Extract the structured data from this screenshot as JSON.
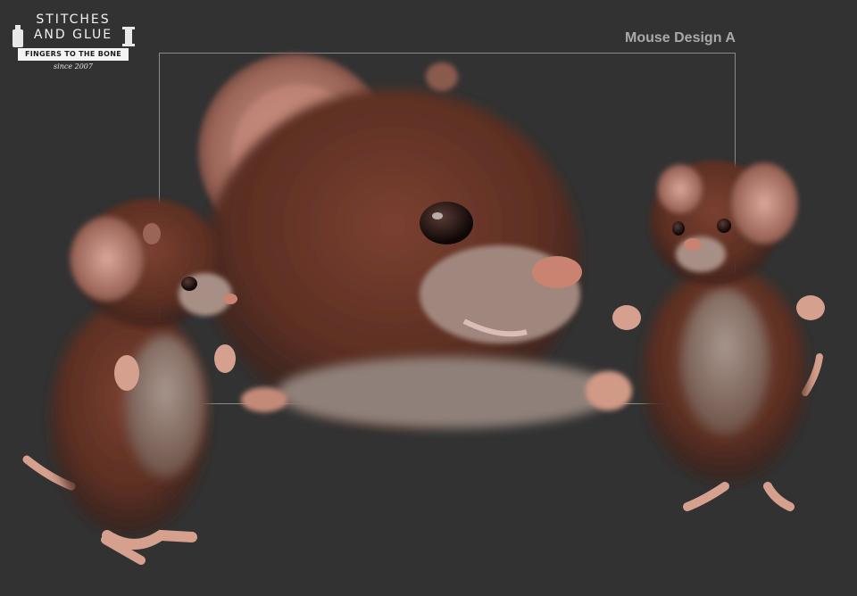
{
  "logo": {
    "line1": "STITCHES",
    "line2": "AND GLUE",
    "ribbon": "FINGERS TO THE BONE",
    "since": "since 2007"
  },
  "title": "Mouse Design A",
  "colors": {
    "background": "#323232",
    "fur": "#5a2e22",
    "belly": "#8e7b72",
    "skin": "#d7a08c",
    "title": "#a9a9a9",
    "frame": "#8a8a8a"
  }
}
